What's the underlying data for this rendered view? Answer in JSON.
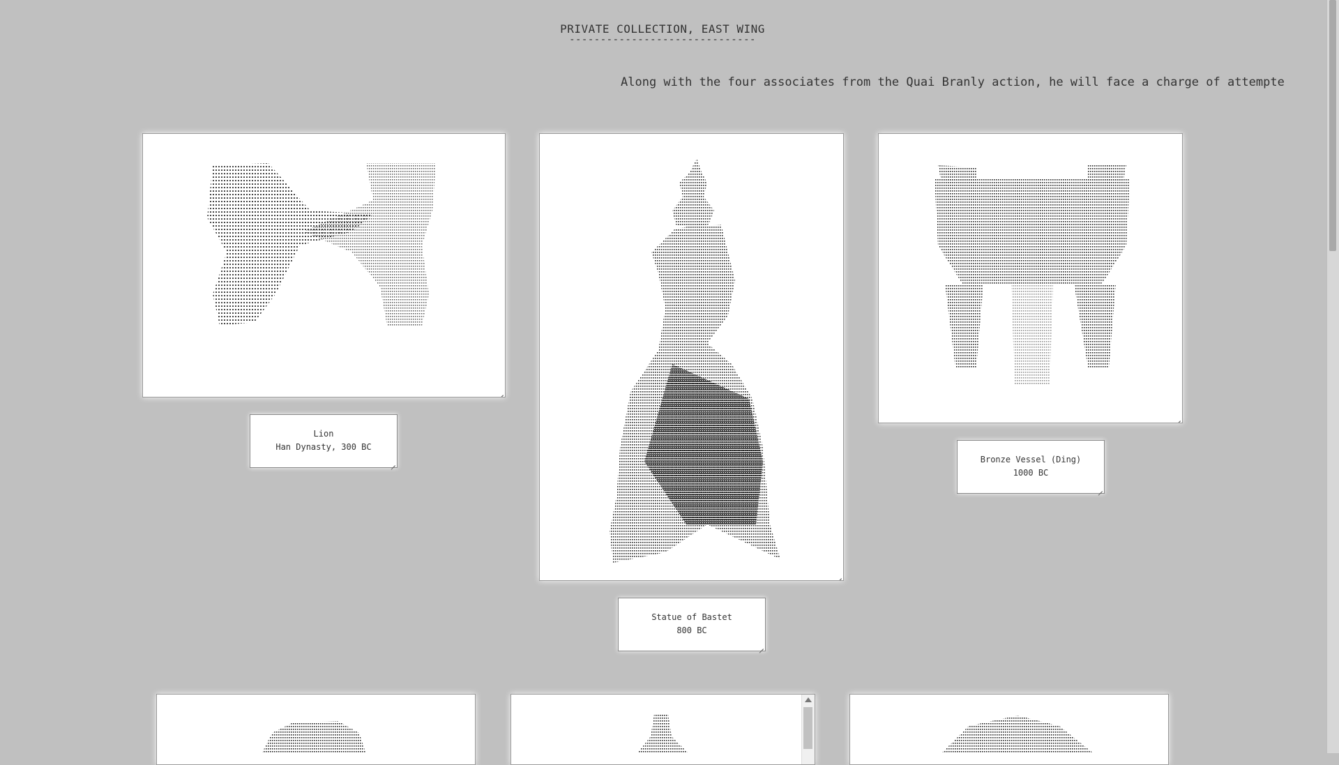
{
  "page": {
    "title": "PRIVATE COLLECTION, EAST WING",
    "title_rule": "------------------------------",
    "ticker": "Along with the four associates from the Quai Branly action, he will face a charge of attempte"
  },
  "exhibits": [
    {
      "id": "lion",
      "name": "Lion",
      "detail": "Han Dynasty, 300 BC",
      "icon": "lion-ascii-art"
    },
    {
      "id": "bastet",
      "name": "Statue of Bastet",
      "detail": "800 BC",
      "icon": "bastet-ascii-art"
    },
    {
      "id": "ding",
      "name": "Bronze Vessel (Ding)",
      "detail": "1000 BC",
      "icon": "ding-ascii-art"
    }
  ],
  "colors": {
    "background": "#c0c0c0",
    "frame": "#ffffff",
    "text": "#333333"
  }
}
